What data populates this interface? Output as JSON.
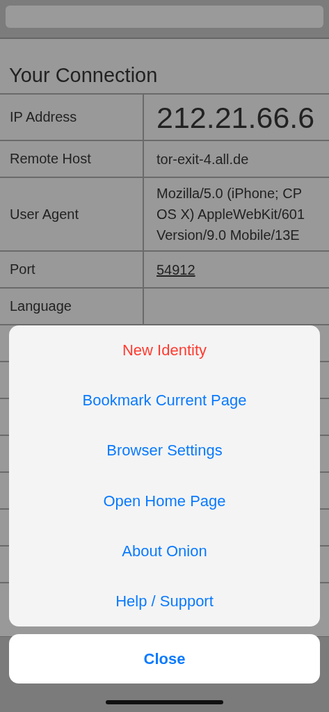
{
  "page": {
    "heading": "Your Connection",
    "rows": [
      {
        "label": "IP Address",
        "kind": "large",
        "lines": [
          "212.21.66.6"
        ]
      },
      {
        "label": "Remote Host",
        "kind": "plain",
        "lines": [
          "tor-exit-4.all.de"
        ]
      },
      {
        "label": "User Agent",
        "kind": "plain",
        "lines": [
          "Mozilla/5.0 (iPhone; CP",
          "OS X) AppleWebKit/601",
          "Version/9.0 Mobile/13E"
        ]
      },
      {
        "label": "Port",
        "kind": "link",
        "lines": [
          "54912"
        ]
      },
      {
        "label": "Language",
        "kind": "plain",
        "lines": []
      }
    ]
  },
  "action_sheet": {
    "items": [
      {
        "label": "New Identity",
        "kind": "destructive"
      },
      {
        "label": "Bookmark Current Page",
        "kind": "default"
      },
      {
        "label": "Browser Settings",
        "kind": "default"
      },
      {
        "label": "Open Home Page",
        "kind": "default"
      },
      {
        "label": "About Onion",
        "kind": "default"
      },
      {
        "label": "Help / Support",
        "kind": "default"
      }
    ],
    "cancel": "Close"
  }
}
